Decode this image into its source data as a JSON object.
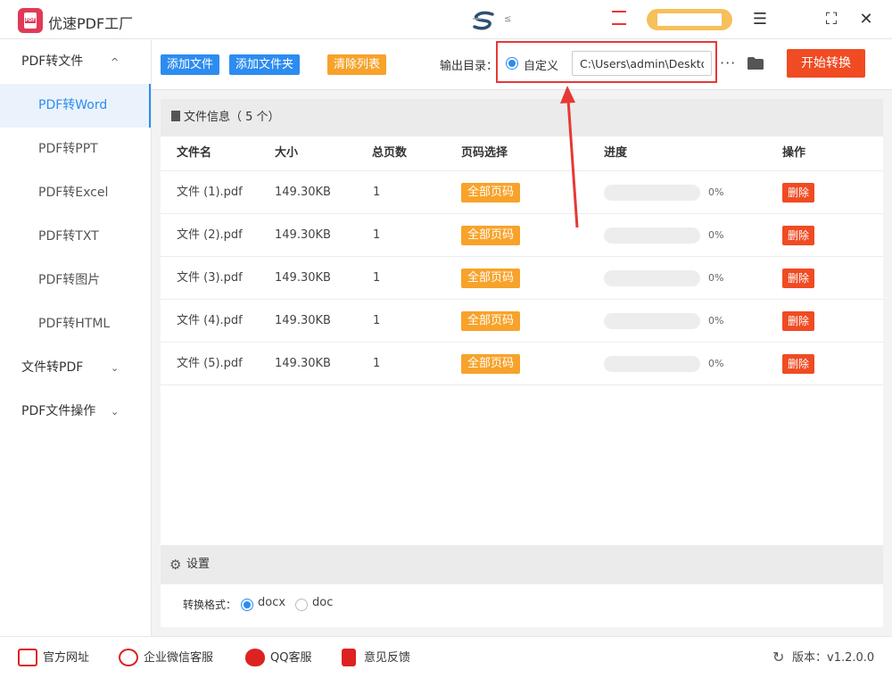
{
  "app": {
    "title": "优速PDF工厂",
    "logo_text": "PDF",
    "center_small": "≤"
  },
  "window": {
    "menu_icon": "☰",
    "max_icon": "⛶",
    "close_icon": "✕"
  },
  "sidebar": {
    "groups": [
      {
        "label": "PDF转文件",
        "chevron": "^"
      },
      {
        "label": "文件转PDF",
        "chevron": "⌄"
      },
      {
        "label": "PDF文件操作",
        "chevron": "⌄"
      }
    ],
    "items": [
      {
        "label": "PDF转Word"
      },
      {
        "label": "PDF转PPT"
      },
      {
        "label": "PDF转Excel"
      },
      {
        "label": "PDF转TXT"
      },
      {
        "label": "PDF转图片"
      },
      {
        "label": "PDF转HTML"
      }
    ]
  },
  "toolbar": {
    "add_file": "添加文件",
    "add_folder": "添加文件夹",
    "clear_list": "清除列表",
    "output_label": "输出目录：",
    "custom_label": "自定义",
    "path_value": "C:\\Users\\admin\\Deskto",
    "more": "···",
    "start": "开始转换"
  },
  "file_panel": {
    "title": "文件信息（ 5 个）",
    "columns": {
      "name": "文件名",
      "size": "大小",
      "pages": "总页数",
      "page_select": "页码选择",
      "progress": "进度",
      "action": "操作"
    },
    "rows": [
      {
        "name": "文件 (1).pdf",
        "size": "149.30KB",
        "pages": "1",
        "page_btn": "全部页码",
        "progress": 0,
        "pct": "0%",
        "del": "删除"
      },
      {
        "name": "文件 (2).pdf",
        "size": "149.30KB",
        "pages": "1",
        "page_btn": "全部页码",
        "progress": 0,
        "pct": "0%",
        "del": "删除"
      },
      {
        "name": "文件 (3).pdf",
        "size": "149.30KB",
        "pages": "1",
        "page_btn": "全部页码",
        "progress": 0,
        "pct": "0%",
        "del": "删除"
      },
      {
        "name": "文件 (4).pdf",
        "size": "149.30KB",
        "pages": "1",
        "page_btn": "全部页码",
        "progress": 0,
        "pct": "0%",
        "del": "删除"
      },
      {
        "name": "文件 (5).pdf",
        "size": "149.30KB",
        "pages": "1",
        "page_btn": "全部页码",
        "progress": 0,
        "pct": "0%",
        "del": "删除"
      }
    ]
  },
  "settings": {
    "title": "设置",
    "gear": "⚙",
    "format_label": "转换格式：",
    "options": [
      {
        "label": "docx",
        "checked": true
      },
      {
        "label": "doc",
        "checked": false
      }
    ]
  },
  "footer": {
    "website": "官方网址",
    "wechat": "企业微信客服",
    "qq": "QQ客服",
    "feedback": "意见反馈",
    "version": "版本：v1.2.0.0",
    "refresh": "↻"
  },
  "colors": {
    "accent": "#2d8cf0",
    "orange": "#f7a32b",
    "danger": "#f04b23",
    "highlight": "#e53935"
  }
}
